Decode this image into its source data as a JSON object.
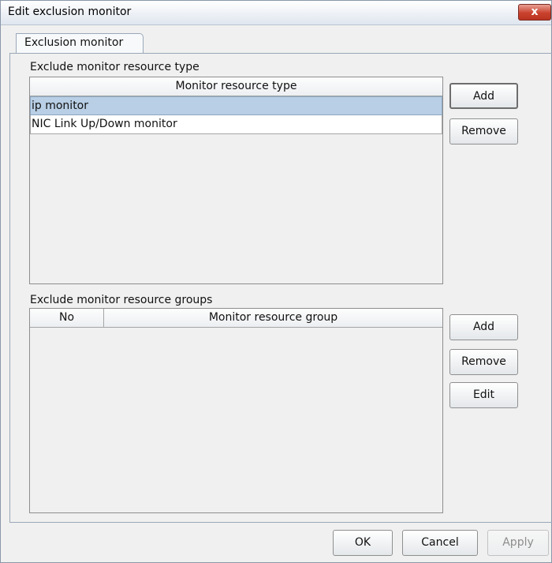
{
  "window": {
    "title": "Edit exclusion monitor",
    "close_label": "x"
  },
  "tab": {
    "label": "Exclusion monitor"
  },
  "resource_type": {
    "section_label": "Exclude monitor resource type",
    "column_header": "Monitor resource type",
    "rows": [
      {
        "label": "ip monitor",
        "selected": true
      },
      {
        "label": "NIC Link Up/Down monitor",
        "selected": false
      }
    ],
    "add_label": "Add",
    "remove_label": "Remove"
  },
  "resource_groups": {
    "section_label": "Exclude monitor resource groups",
    "columns": [
      "No",
      "Monitor resource group"
    ],
    "rows": [],
    "add_label": "Add",
    "remove_label": "Remove",
    "edit_label": "Edit"
  },
  "footer": {
    "ok_label": "OK",
    "cancel_label": "Cancel",
    "apply_label": "Apply",
    "apply_enabled": false
  }
}
